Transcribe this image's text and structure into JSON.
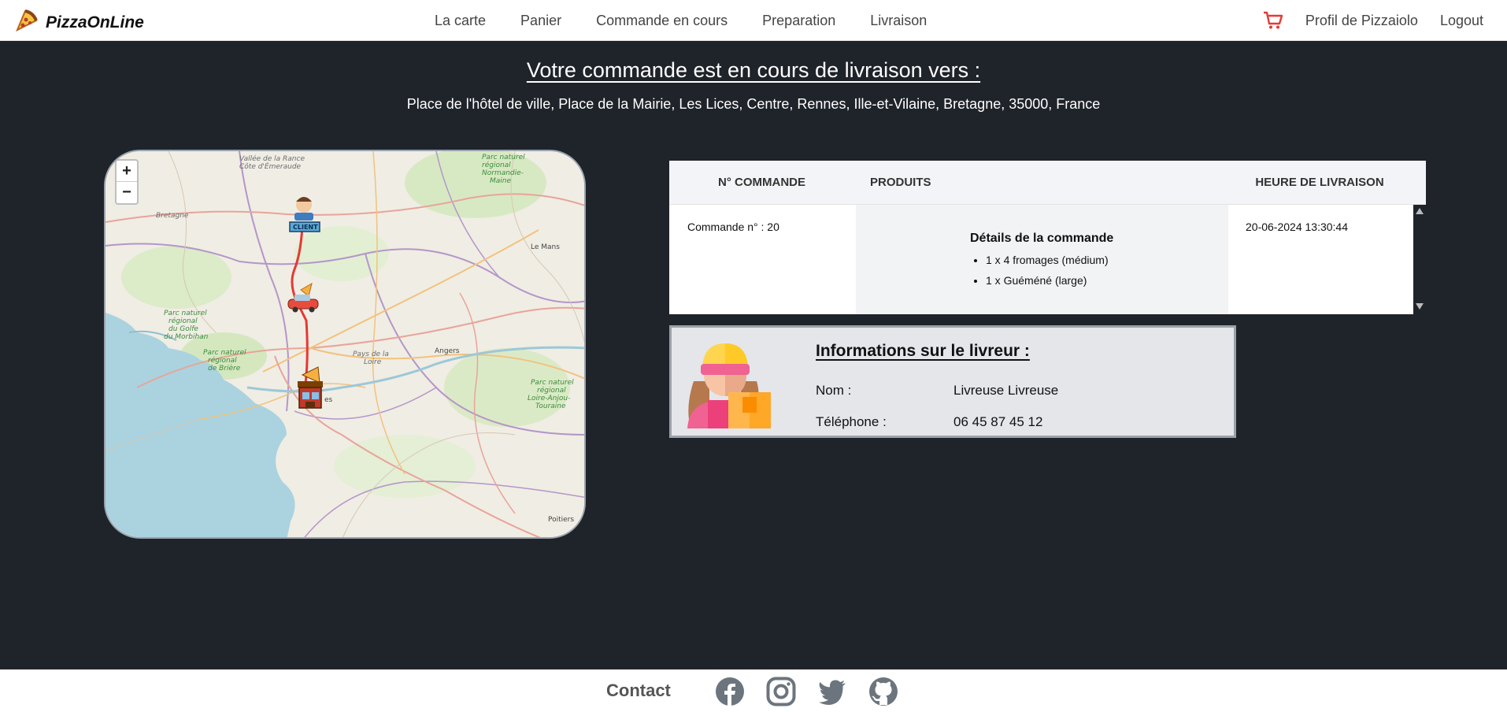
{
  "navbar": {
    "brand": "PizzaOnLine",
    "links": [
      "La carte",
      "Panier",
      "Commande en cours",
      "Preparation",
      "Livraison"
    ],
    "profile": "Profil de Pizzaiolo",
    "logout": "Logout"
  },
  "hero": {
    "title": "Votre commande est en cours de livraison vers :",
    "address": "Place de l'hôtel de ville, Place de la Mairie, Les Lices, Centre, Rennes, Ille-et-Vilaine, Bretagne, 35000, France"
  },
  "map": {
    "zoom_in": "+",
    "zoom_out": "−",
    "client_badge": "CLIENT",
    "labels": [
      "Vallée de la Rance Côte d'Émeraude",
      "Bretagne",
      "Parc naturel régional Normandie-Maine",
      "Le Mans",
      "Parc naturel régional du Golfe du Morbihan",
      "Parc naturel régional de Brière",
      "Pays de la Loire",
      "Angers",
      "Parc naturel régional Loire-Anjou-Touraine",
      "Poitiers",
      "es"
    ],
    "route_color": "#e53935"
  },
  "order": {
    "headers": [
      "N° COMMANDE",
      "PRODUITS",
      "HEURE DE LIVRAISON"
    ],
    "number": "Commande n° : 20",
    "details_title": "Détails de la commande",
    "items": [
      "1 x 4 fromages (médium)",
      "1 x Guéméné (large)"
    ],
    "time": "20-06-2024 13:30:44"
  },
  "driver": {
    "title": "Informations sur le livreur :",
    "name_label": "Nom :",
    "name": "Livreuse Livreuse",
    "phone_label": "Téléphone :",
    "phone": "06 45 87 45 12"
  },
  "footer": {
    "contact": "Contact",
    "icons": [
      "facebook-icon",
      "instagram-icon",
      "twitter-icon",
      "github-icon"
    ]
  },
  "colors": {
    "background": "#1f232a",
    "cart": "#e53935"
  }
}
